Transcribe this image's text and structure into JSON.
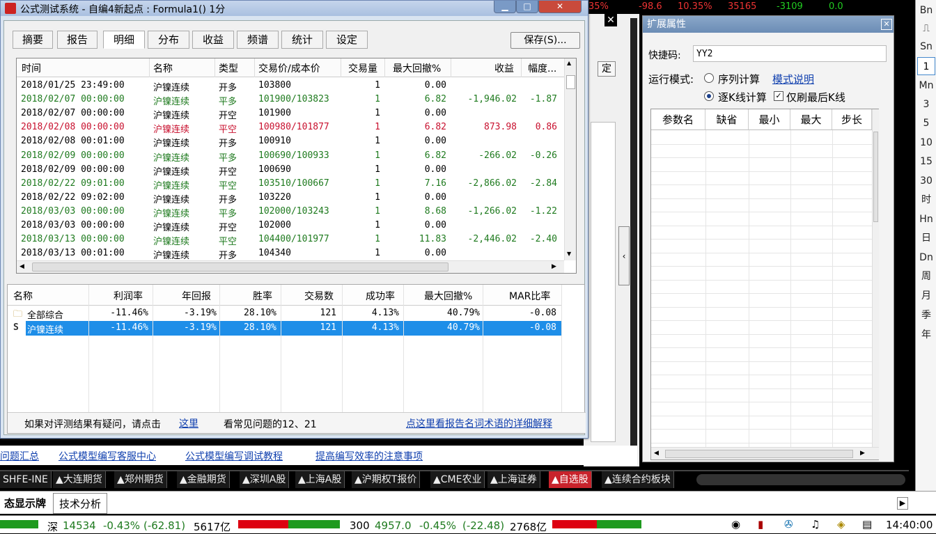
{
  "window": {
    "title": "公式测试系统 - 自编4新起点 : Formula1() 1分"
  },
  "tabs": [
    {
      "label": "摘要"
    },
    {
      "label": "报告"
    },
    {
      "label": "明细"
    },
    {
      "label": "分布"
    },
    {
      "label": "收益"
    },
    {
      "label": "频谱"
    },
    {
      "label": "统计"
    },
    {
      "label": "设定"
    }
  ],
  "save_label": "保存(S)...",
  "trades": {
    "headers": [
      "时间",
      "名称",
      "类型",
      "交易价/成本价",
      "交易量",
      "最大回撤%",
      "收益",
      "幅度..."
    ],
    "rows": [
      {
        "time": "2018/01/25 23:49:00",
        "name": "沪镍连续",
        "type": "开多",
        "price": "103800",
        "qty": "1",
        "dd": "0.00",
        "profit": "",
        "range": "",
        "color": "blk"
      },
      {
        "time": "2018/02/07 00:00:00",
        "name": "沪镍连续",
        "type": "平多",
        "price": "101900/103823",
        "qty": "1",
        "dd": "6.82",
        "profit": "-1,946.02",
        "range": "-1.87",
        "color": "grn"
      },
      {
        "time": "2018/02/07 00:00:00",
        "name": "沪镍连续",
        "type": "开空",
        "price": "101900",
        "qty": "1",
        "dd": "0.00",
        "profit": "",
        "range": "",
        "color": "blk"
      },
      {
        "time": "2018/02/08 00:00:00",
        "name": "沪镍连续",
        "type": "平空",
        "price": "100980/101877",
        "qty": "1",
        "dd": "6.82",
        "profit": "873.98",
        "range": "0.86",
        "color": "red"
      },
      {
        "time": "2018/02/08 00:01:00",
        "name": "沪镍连续",
        "type": "开多",
        "price": "100910",
        "qty": "1",
        "dd": "0.00",
        "profit": "",
        "range": "",
        "color": "blk"
      },
      {
        "time": "2018/02/09 00:00:00",
        "name": "沪镍连续",
        "type": "平多",
        "price": "100690/100933",
        "qty": "1",
        "dd": "6.82",
        "profit": "-266.02",
        "range": "-0.26",
        "color": "grn"
      },
      {
        "time": "2018/02/09 00:00:00",
        "name": "沪镍连续",
        "type": "开空",
        "price": "100690",
        "qty": "1",
        "dd": "0.00",
        "profit": "",
        "range": "",
        "color": "blk"
      },
      {
        "time": "2018/02/22 09:01:00",
        "name": "沪镍连续",
        "type": "平空",
        "price": "103510/100667",
        "qty": "1",
        "dd": "7.16",
        "profit": "-2,866.02",
        "range": "-2.84",
        "color": "grn"
      },
      {
        "time": "2018/02/22 09:02:00",
        "name": "沪镍连续",
        "type": "开多",
        "price": "103220",
        "qty": "1",
        "dd": "0.00",
        "profit": "",
        "range": "",
        "color": "blk"
      },
      {
        "time": "2018/03/03 00:00:00",
        "name": "沪镍连续",
        "type": "平多",
        "price": "102000/103243",
        "qty": "1",
        "dd": "8.68",
        "profit": "-1,266.02",
        "range": "-1.22",
        "color": "grn"
      },
      {
        "time": "2018/03/03 00:00:00",
        "name": "沪镍连续",
        "type": "开空",
        "price": "102000",
        "qty": "1",
        "dd": "0.00",
        "profit": "",
        "range": "",
        "color": "blk"
      },
      {
        "time": "2018/03/13 00:00:00",
        "name": "沪镍连续",
        "type": "平空",
        "price": "104400/101977",
        "qty": "1",
        "dd": "11.83",
        "profit": "-2,446.02",
        "range": "-2.40",
        "color": "grn"
      },
      {
        "time": "2018/03/13 00:01:00",
        "name": "沪镍连续",
        "type": "开多",
        "price": "104340",
        "qty": "1",
        "dd": "0.00",
        "profit": "",
        "range": "",
        "color": "blk"
      }
    ]
  },
  "summary": {
    "headers": [
      "名称",
      "利润率",
      "年回报",
      "胜率",
      "交易数",
      "成功率",
      "最大回撤%",
      "MAR比率"
    ],
    "rows": [
      {
        "icon": "folder-icon",
        "name": "全部综合",
        "profit_rate": "-11.46%",
        "annual": "-3.19%",
        "win": "28.10%",
        "count": "121",
        "success": "4.13%",
        "dd": "40.79%",
        "mar": "-0.08"
      },
      {
        "icon": "S",
        "name": "沪镍连续",
        "profit_rate": "-11.46%",
        "annual": "-3.19%",
        "win": "28.10%",
        "count": "121",
        "success": "4.13%",
        "dd": "40.79%",
        "mar": "-0.08"
      }
    ]
  },
  "footer": {
    "question": "如果对评测结果有疑问，请点击",
    "here": "这里",
    "faq": "看常见问题的12、21",
    "glossary_link": "点这里看报告名词术语的详细解释"
  },
  "ext_panel": {
    "title": "扩展属性",
    "shortcut_label": "快捷码:",
    "shortcut_value": "YY2",
    "mode_label": "运行模式:",
    "mode_seq": "序列计算",
    "mode_help": "模式说明",
    "mode_bar": "逐K线计算",
    "refresh_last": "仅刷最后K线",
    "param_headers": [
      "参数名",
      "缺省",
      "最小",
      "最大",
      "步长"
    ]
  },
  "background": {
    "ticker": [
      "35%",
      "-98.6",
      "10.35%",
      "35165",
      "-3109",
      "0.0"
    ],
    "ok_fragment": "定",
    "links": [
      "问题汇总",
      "公式模型编写客服中心",
      "公式模型编写调试教程",
      "提高编写效率的注意事项"
    ],
    "market_tabs": [
      "SHFE-INE",
      "▲大连期货",
      "▲郑州期货",
      "▲金融期货",
      "▲深圳A股",
      "▲上海A股",
      "▲沪期权T报价",
      "▲CME农业",
      "▲上海证券",
      "▲自选股",
      "▲连续合约板块"
    ],
    "bottom_tabs": [
      "态显示牌",
      "技术分析"
    ],
    "status": {
      "sz_label": "深",
      "sz_value": "14534",
      "sz_pct": "-0.43%",
      "sz_chg": "(-62.81)",
      "sz_amt": "5617亿",
      "c300_label": "300",
      "c300_value": "4957.0",
      "c300_pct": "-0.45%",
      "c300_chg": "(-22.48)",
      "c300_amt": "2768亿",
      "time": "14:40:00"
    },
    "right_toolbar": [
      "Bn",
      "",
      "Sn",
      "1",
      "Mn",
      "3",
      "5",
      "10",
      "15",
      "30",
      "时",
      "Hn",
      "日",
      "Dn",
      "周",
      "月",
      "季",
      "年"
    ]
  }
}
